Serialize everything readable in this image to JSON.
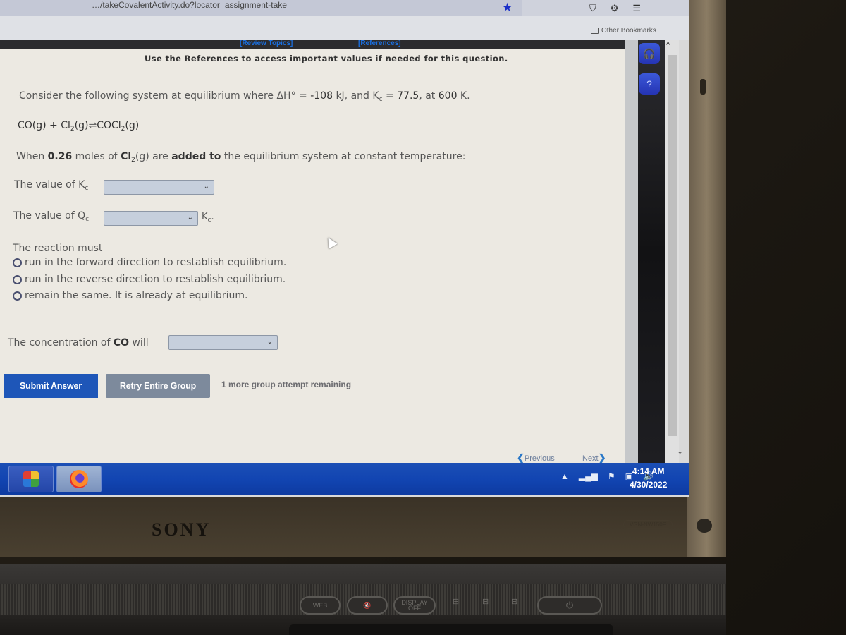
{
  "browser": {
    "url_text": "…/takeCovalentActivity.do?locator=assignment-take",
    "bookmarks_folder": "Other Bookmarks",
    "icons": [
      "bookmark-star-icon",
      "pocket-icon",
      "extensions-icon",
      "hamburger-menu-icon"
    ]
  },
  "page": {
    "topbar_links": {
      "review_topics": "[Review Topics]",
      "references": "[References]"
    },
    "reference_note": "Use the References to access important values if needed for this question.",
    "question": {
      "intro_prefix": "Consider the following system at equilibrium where ΔH° = ",
      "delta_h": "-108",
      "delta_h_unit": " kJ, and K",
      "kc_sub": "c",
      "kc_eq": " = ",
      "kc_value": "77.5",
      "temp_prefix": ", at ",
      "temp_value": "600",
      "temp_unit": " K.",
      "equation": {
        "r1": "CO(g) + Cl",
        "r1_sub": "2",
        "r1_end": "(g)",
        "arrow": "⇌",
        "p1": "COCl",
        "p1_sub": "2",
        "p1_end": "(g)"
      },
      "change_prefix": "When ",
      "change_amount": "0.26",
      "change_mid": " moles of ",
      "change_species": "Cl",
      "change_species_sub": "2",
      "change_species_end": "(g)",
      "change_are": " are ",
      "change_action": "added to",
      "change_suffix": " the equilibrium system at constant temperature:"
    },
    "kc_row": {
      "label": "The value of K",
      "label_sub": "c",
      "selected": ""
    },
    "qc_row": {
      "label": "The value of Q",
      "label_sub": "c",
      "selected": "",
      "suffix": "K",
      "suffix_sub": "c",
      "suffix_end": "."
    },
    "reaction": {
      "label": "The reaction must",
      "options": [
        "run in the forward direction to restablish equilibrium.",
        "run in the reverse direction to restablish equilibrium.",
        "remain the same.  It is already at equilibrium."
      ]
    },
    "co_row": {
      "label_prefix": "The concentration of ",
      "species": "CO",
      "label_suffix": " will",
      "selected": ""
    },
    "buttons": {
      "submit": "Submit Answer",
      "retry": "Retry Entire Group"
    },
    "attempts_text": "1 more group attempt remaining",
    "nav": {
      "previous": "Previous",
      "next": "Next"
    }
  },
  "taskbar": {
    "apps": [
      "control-panel",
      "firefox"
    ],
    "time": "4:14 AM",
    "date": "4/30/2022"
  },
  "hardware": {
    "brand": "SONY",
    "model": "VGN-NW150F",
    "buttons": {
      "web": "WEB",
      "mute": "🔇",
      "display_off_1": "DISPLAY",
      "display_off_2": "OFF"
    }
  },
  "colors": {
    "submit_bg": "#1e56b8",
    "retry_bg": "#7d8a9c",
    "link": "#1a6fe0",
    "taskbar": "#1245b2"
  }
}
